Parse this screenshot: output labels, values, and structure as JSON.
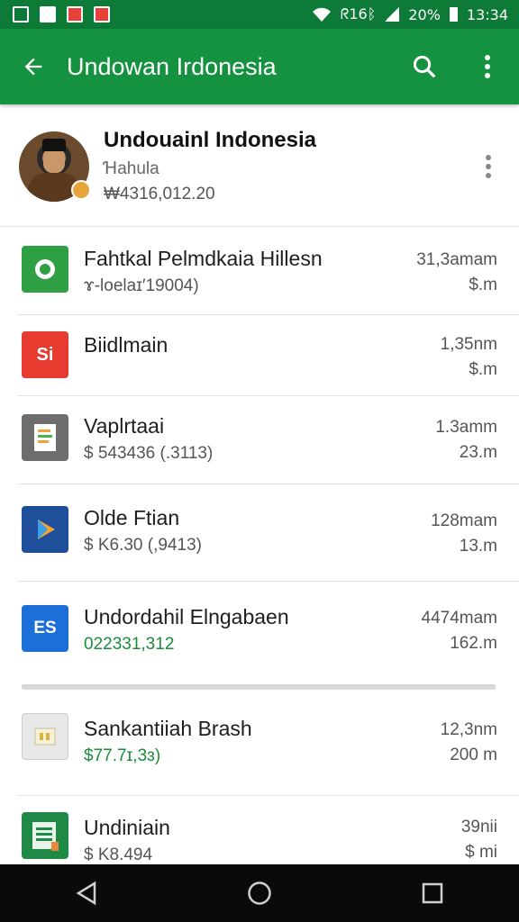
{
  "status_bar": {
    "icons_left": [
      "image-icon",
      "file-icon",
      "alert-icon",
      "news-icon"
    ],
    "right_text": "ᖇ16ᛒ",
    "battery": "20%",
    "time": "13:34"
  },
  "app_bar": {
    "title": "Undowan Irdonesia",
    "back_icon": "arrow-left-icon",
    "search_icon": "search-icon",
    "menu_icon": "more-vertical-icon"
  },
  "profile": {
    "name": "Undouainl Indonesia",
    "subtitle": "Ɦahula",
    "amount": "₩4316,012.20"
  },
  "items": [
    {
      "title": "Fahtkal Pelmdkaia Hillesn",
      "subtitle": "ɤ-loelaɪ′19004)",
      "time": "31,3amam",
      "size": "$.m",
      "icon_color": "#2ea043",
      "icon_label": "◉",
      "green": false
    },
    {
      "title": "Biidlmain",
      "subtitle": "",
      "time": "1,35nm",
      "size": "$.m",
      "icon_color": "#e63b2e",
      "icon_label": "Si",
      "green": false
    },
    {
      "title": "Vaplrtaai",
      "subtitle": "$ 543436 (.3113)",
      "time": "1.3amm",
      "size": "23.m",
      "icon_color": "#6d6d6d",
      "icon_label": "≡",
      "green": false
    },
    {
      "title": "Olde Ftian",
      "subtitle": "$ K6.30 (,9413)",
      "time": "128mam",
      "size": "13.m",
      "icon_color": "#1f5fbf",
      "icon_label": "▶",
      "green": false
    },
    {
      "title": "Undordahil Elngabaen",
      "subtitle": "022331,312",
      "time": "4474mam",
      "size": "162.m",
      "icon_color": "#1c6fd6",
      "icon_label": "ES",
      "green": true
    },
    {
      "title": "Sankantiiah Brash",
      "subtitle": "$77.7ɪ,3ɜ)",
      "time": "12,3nm",
      "size": "200 m",
      "icon_color": "#e6e6e6",
      "icon_label": "▫",
      "green": true
    },
    {
      "title": "Undiniain",
      "subtitle": "$ K8.494",
      "time": "39nii",
      "size": "$ mi",
      "icon_color": "#1e8a46",
      "icon_label": "≣",
      "green": false
    }
  ],
  "nav": {
    "back": "nav-back-icon",
    "home": "nav-home-icon",
    "recents": "nav-recents-icon"
  },
  "colors": {
    "app_bar": "#15923f",
    "status_bar": "#0d7a37",
    "green_text": "#1a8c3a"
  }
}
